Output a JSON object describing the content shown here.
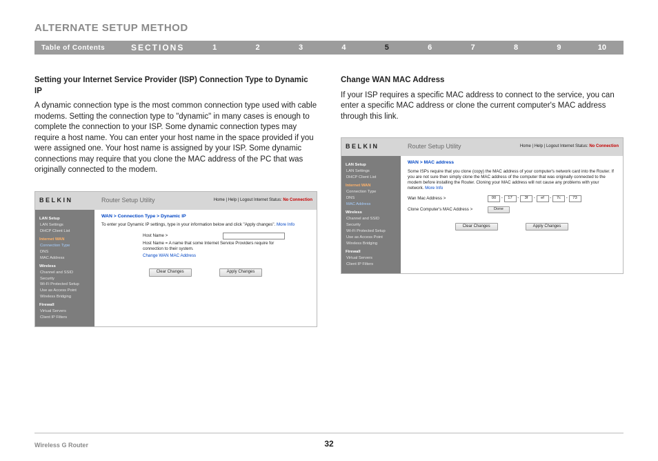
{
  "title": "ALTERNATE SETUP METHOD",
  "nav": {
    "toc": "Table of Contents",
    "sections_label": "SECTIONS",
    "numbers": [
      "1",
      "2",
      "3",
      "4",
      "5",
      "6",
      "7",
      "8",
      "9",
      "10"
    ],
    "active_index": 4
  },
  "left": {
    "heading": "Setting your Internet Service Provider (ISP) Connection Type to Dynamic IP",
    "body": "A dynamic connection type is the most common connection type used with cable modems. Setting the connection type to \"dynamic\" in many cases is enough to complete the connection to your ISP. Some dynamic connection types may require a host name. You can enter your host name in the space provided if you were assigned one. Your host name is assigned by your ISP. Some dynamic connections may require that you clone the MAC address of the PC that was originally connected to the modem."
  },
  "right": {
    "heading": "Change WAN MAC Address",
    "body": "If your ISP requires a specific MAC address to connect to the service, you can enter a specific MAC address or clone the current computer's MAC address through this link."
  },
  "panel_common": {
    "logo": "BELKIN",
    "app_title": "Router Setup Utility",
    "links_prefix": "Home | Help | Logout   Internet Status:",
    "status": "No Connection",
    "clear_btn": "Clear Changes",
    "apply_btn": "Apply Changes",
    "more_info": "More Info"
  },
  "panel_left": {
    "crumb": "WAN > Connection Type > Dynamic IP",
    "desc": "To enter your Dynamic IP settings, type in your information below and click \"Apply changes\".",
    "host_label": "Host Name >",
    "host_note": "Host Name = A name that some Internet Service Providers require for connection to their system.",
    "change_link": "Change WAN MAC Address",
    "sidebar": {
      "lan_setup": "LAN Setup",
      "lan_settings": "LAN Settings",
      "dhcp": "DHCP Client List",
      "internet_wan": "Internet WAN",
      "conn_type": "Connection Type",
      "dns": "DNS",
      "mac": "MAC Address",
      "wireless": "Wireless",
      "chan_ssid": "Channel and SSID",
      "security": "Security",
      "wps": "Wi-Fi Protected Setup",
      "uap": "Use as Access Point",
      "wb": "Wireless Bridging",
      "firewall": "Firewall",
      "vs": "Virtual Servers",
      "cif": "Client IP Filters"
    }
  },
  "panel_right": {
    "crumb": "WAN > MAC address",
    "desc": "Some ISPs require that you clone (copy) the MAC address of your computer's network card into the Router. If you are not sure then simply clone the MAC address of the computer that was originally connected to the modem before installing the Router. Cloning your MAC address will not cause any problems with your network.",
    "wan_mac_label": "Wan Mac Address >",
    "clone_label": "Clone Computer's MAC Address >",
    "done": "Done",
    "mac": [
      "00",
      "17",
      "3f",
      "ef",
      "7c",
      "73"
    ],
    "sidebar": {
      "lan_setup": "LAN Setup",
      "lan_settings": "LAN Settings",
      "dhcp": "DHCP Client List",
      "internet_wan": "Internet WAN",
      "conn_type": "Connection Type",
      "dns": "DNS",
      "mac": "MAC Address",
      "wireless": "Wireless",
      "chan_ssid": "Channel and SSID",
      "security": "Security",
      "wps": "Wi-Fi Protected Setup",
      "uap": "Use as Access Point",
      "wb": "Wireless Bridging",
      "firewall": "Firewall",
      "vs": "Virtual Servers",
      "cif": "Client IP Filters"
    }
  },
  "footer": {
    "product": "Wireless G Router",
    "page": "32"
  }
}
